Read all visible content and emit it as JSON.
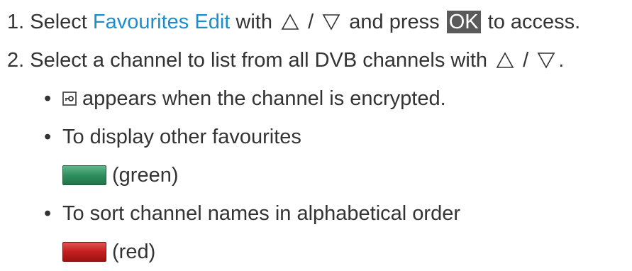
{
  "steps": [
    {
      "number": "1.",
      "pre": "Select ",
      "link": "Favourites Edit",
      "mid": " with ",
      "sep": " / ",
      "post_a": " and press ",
      "key": "OK",
      "post_b": " to access."
    },
    {
      "number": "2.",
      "text": "Select a channel to list from all DVB channels with ",
      "sep": " / ",
      "end": "."
    }
  ],
  "bullets": [
    {
      "bullet": "•",
      "icon": "lock-icon",
      "text": "appears when the channel is encrypted."
    },
    {
      "bullet": "•",
      "text": "To display other favourites"
    },
    {
      "bullet": "•",
      "text": "To sort channel names in alphabetical order"
    }
  ],
  "color_keys": [
    {
      "name": "green-key-icon",
      "label": "(green)",
      "color": "#2f8f5e"
    },
    {
      "name": "red-key-icon",
      "label": "(red)",
      "color": "#c41e1e"
    }
  ]
}
